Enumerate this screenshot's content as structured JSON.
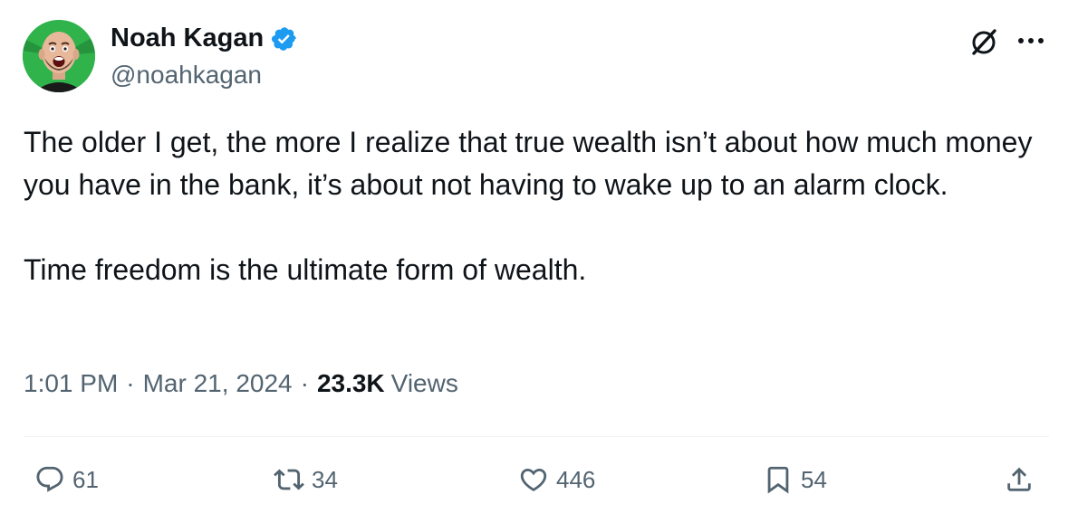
{
  "author": {
    "display_name": "Noah Kagan",
    "handle": "@noahkagan",
    "verified": true,
    "avatar_bg": "#2fb34a"
  },
  "tweet": {
    "paragraphs": [
      "The older I get, the more I realize that true wealth isn’t about how much money you have in the bank, it’s about not having to wake up to an alarm clock.",
      "Time freedom is the ultimate form of wealth."
    ]
  },
  "meta": {
    "time": "1:01 PM",
    "separator": "·",
    "date": "Mar 21, 2024",
    "views_count": "23.3K",
    "views_label": "Views"
  },
  "actions": {
    "replies": "61",
    "reposts": "34",
    "likes": "446",
    "bookmarks": "54"
  },
  "icons": {
    "grok": "grok-icon",
    "more": "more-icon",
    "reply": "reply-icon",
    "repost": "repost-icon",
    "like": "heart-icon",
    "bookmark": "bookmark-icon",
    "share": "share-icon",
    "verified": "verified-badge-icon"
  },
  "colors": {
    "text_primary": "#0f1419",
    "text_secondary": "#536471",
    "verified_blue": "#1d9bf0",
    "divider": "#eff3f4"
  }
}
